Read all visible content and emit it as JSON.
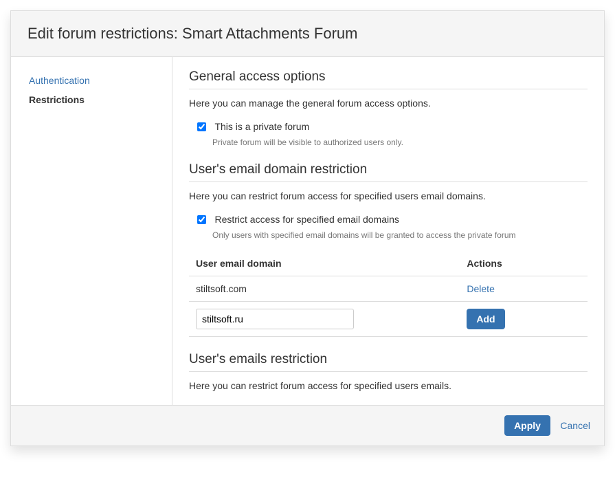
{
  "header": {
    "title": "Edit forum restrictions: Smart Attachments Forum"
  },
  "sidebar": {
    "items": [
      {
        "label": "Authentication",
        "active": false
      },
      {
        "label": "Restrictions",
        "active": true
      }
    ]
  },
  "sections": {
    "general": {
      "title": "General access options",
      "desc": "Here you can manage the general forum access options.",
      "private_label": "This is a private forum",
      "private_hint": "Private forum will be visible to authorized users only.",
      "private_checked": true
    },
    "domain": {
      "title": "User's email domain restriction",
      "desc": "Here you can restrict forum access for specified users email domains.",
      "restrict_label": "Restrict access for specified email domains",
      "restrict_hint": "Only users with specified email domains will be granted to access the private forum",
      "restrict_checked": true,
      "table": {
        "col_domain": "User email domain",
        "col_actions": "Actions",
        "rows": [
          {
            "domain": "stiltsoft.com",
            "action": "Delete"
          }
        ],
        "input_value": "stiltsoft.ru",
        "add_label": "Add"
      }
    },
    "emails": {
      "title": "User's emails restriction",
      "desc": "Here you can restrict forum access for specified users emails."
    }
  },
  "footer": {
    "apply": "Apply",
    "cancel": "Cancel"
  }
}
